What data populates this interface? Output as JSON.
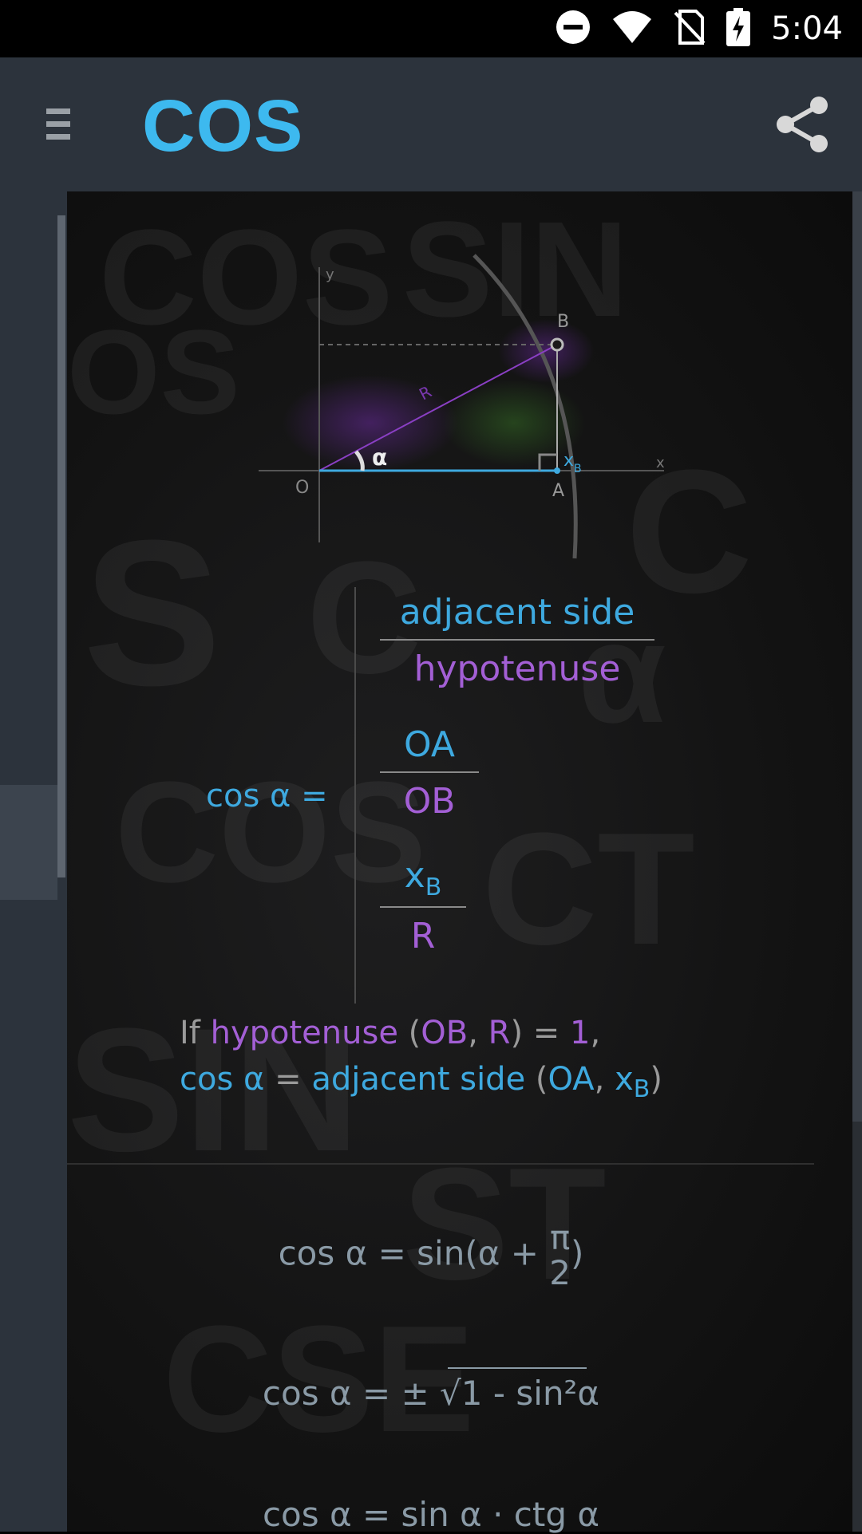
{
  "status_bar": {
    "time": "5:04",
    "icons": [
      "do-not-disturb-icon",
      "wifi-icon",
      "no-sim-icon",
      "battery-charging-icon"
    ]
  },
  "app_bar": {
    "title": "COS",
    "menu_icon": "menu-icon",
    "share_icon": "share-icon"
  },
  "diagram": {
    "y_label": "y",
    "x_label": "x",
    "origin_label": "O",
    "point_b": "B",
    "point_a": "A",
    "radius_label": "R",
    "angle_label": "α",
    "xb_label": "x",
    "xb_sub": "B"
  },
  "formula": {
    "lhs": "cos α =",
    "fractions": [
      {
        "numerator": "adjacent side",
        "denominator": "hypotenuse"
      },
      {
        "numerator": "OA",
        "denominator": "OB"
      },
      {
        "numerator": "x",
        "numerator_sub": "B",
        "denominator": "R"
      }
    ]
  },
  "note": {
    "line1_if": "If ",
    "line1_hyp": "hypotenuse",
    "line1_open": " (",
    "line1_ob": "OB",
    "line1_comma": ", ",
    "line1_r": "R",
    "line1_close": ") = ",
    "line1_one": "1",
    "line1_end": ",",
    "line2_cos": "cos α",
    "line2_eq": " = ",
    "line2_adj": "adjacent side",
    "line2_open": " (",
    "line2_oa": "OA",
    "line2_comma": ", ",
    "line2_x": "x",
    "line2_sub": "B",
    "line2_close": ")"
  },
  "identities": {
    "identity1_left": "cos α = sin(α + ",
    "identity1_pi": "π",
    "identity1_two": "2",
    "identity1_right": ")",
    "identity2": "cos α = ± √1 - sin²α",
    "identity3": "cos α = sin α · ctg α"
  },
  "colors": {
    "accent": "#3db9ef",
    "adjacent_blue": "#3ea9df",
    "hypotenuse_purple": "#a35fd5",
    "app_bar": "#2c333c"
  }
}
